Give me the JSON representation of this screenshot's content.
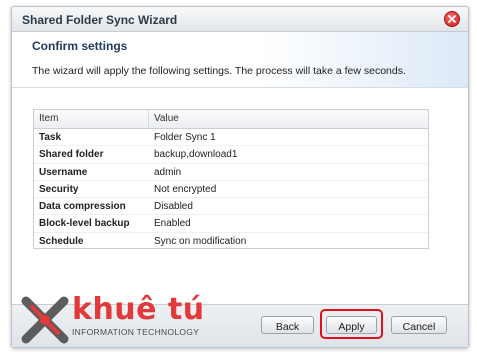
{
  "window": {
    "title": "Shared Folder Sync Wizard"
  },
  "step": {
    "title": "Confirm settings",
    "description": "The wizard will apply the following settings. The process will take a few seconds."
  },
  "table": {
    "columns": [
      "Item",
      "Value"
    ],
    "rows": [
      {
        "item": "Task",
        "value": "Folder Sync 1"
      },
      {
        "item": "Shared folder",
        "value": "backup,download1"
      },
      {
        "item": "Username",
        "value": "admin"
      },
      {
        "item": "Security",
        "value": "Not encrypted"
      },
      {
        "item": "Data compression",
        "value": "Disabled"
      },
      {
        "item": "Block-level backup",
        "value": "Enabled"
      },
      {
        "item": "Schedule",
        "value": "Sync on modification"
      }
    ]
  },
  "buttons": {
    "back": "Back",
    "apply": "Apply",
    "cancel": "Cancel"
  },
  "watermark": {
    "brand": "khuê tú",
    "tagline": "INFORMATION TECHNOLOGY"
  },
  "colors": {
    "highlight": "#e0101a",
    "close": "#d32626",
    "brand": "#e23a3a"
  }
}
